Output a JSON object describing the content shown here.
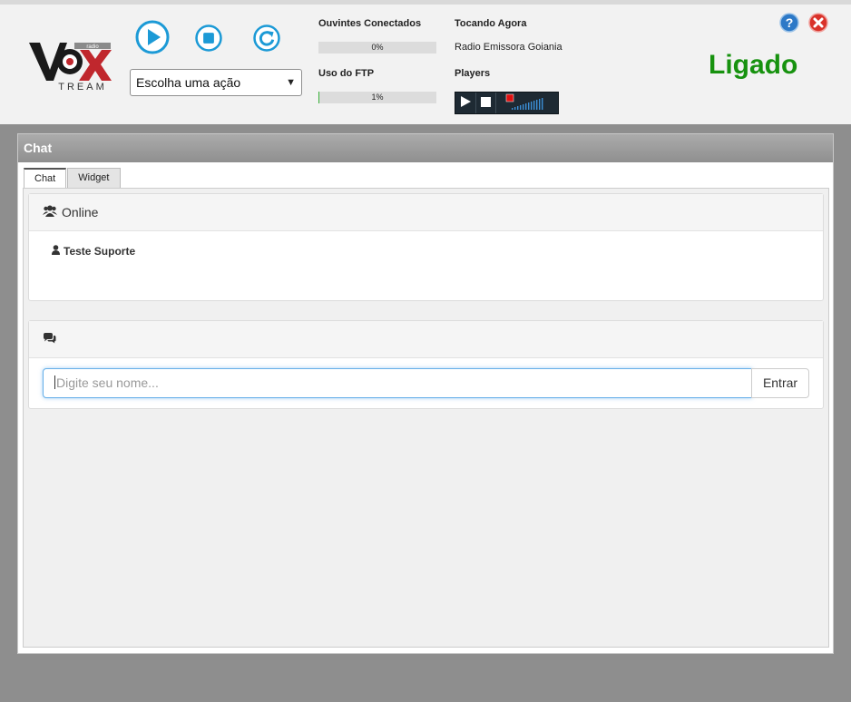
{
  "header": {
    "logo_alt": "VOX STREAM",
    "logo_top": "VOX",
    "logo_sub": "TREAM",
    "logo_tag": "radio",
    "action_select": "Escolha uma ação",
    "listeners_label": "Ouvintes Conectados",
    "listeners_percent": "0%",
    "listeners_value": 0,
    "ftp_label": "Uso do FTP",
    "ftp_percent": "1%",
    "ftp_value": 1,
    "now_playing_label": "Tocando Agora",
    "now_playing_value": "Radio Emissora Goiania",
    "players_label": "Players",
    "status": "Ligado",
    "status_color": "#17920f"
  },
  "panel": {
    "title": "Chat",
    "tabs": [
      "Chat",
      "Widget"
    ],
    "active_tab": "Chat"
  },
  "online": {
    "title": "Online",
    "users": [
      "Teste Suporte"
    ]
  },
  "chat": {
    "name_placeholder": "Digite seu nome...",
    "enter_button": "Entrar"
  },
  "colors": {
    "accent_blue": "#1c9ad6",
    "help_blue": "#2d79c7",
    "close_red": "#d9322a"
  }
}
